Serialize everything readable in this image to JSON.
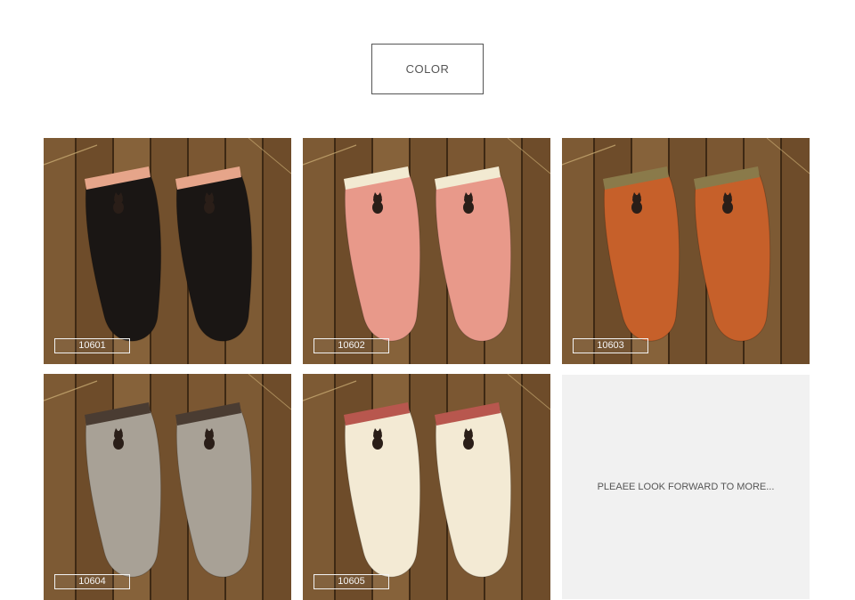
{
  "header": {
    "title": "COLOR"
  },
  "products": [
    {
      "code": "10601",
      "sock_color": "#1a1614",
      "cuff_color": "#e6a58a",
      "motif": "cat-icon"
    },
    {
      "code": "10602",
      "sock_color": "#e8998a",
      "cuff_color": "#f2ead2",
      "motif": "cat-icon"
    },
    {
      "code": "10603",
      "sock_color": "#c6602a",
      "cuff_color": "#8a7a4a",
      "motif": "cat-icon"
    },
    {
      "code": "10604",
      "sock_color": "#a8a196",
      "cuff_color": "#4a3c32",
      "motif": "cat-icon"
    },
    {
      "code": "10605",
      "sock_color": "#f3ead4",
      "cuff_color": "#b8574e",
      "motif": "cat-icon"
    }
  ],
  "placeholder": {
    "text": "PLEAEE LOOK FORWARD TO MORE..."
  }
}
